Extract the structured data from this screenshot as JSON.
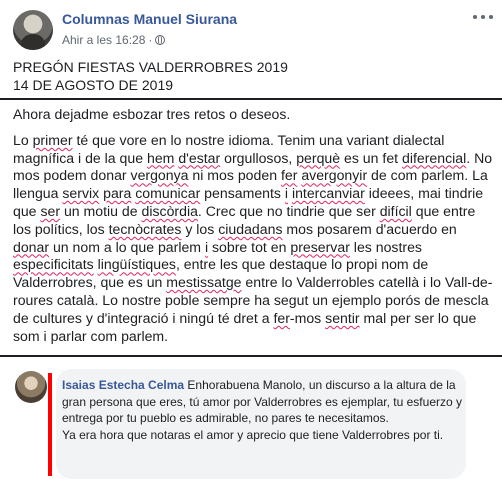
{
  "post": {
    "author": "Columnas Manuel Siurana",
    "time": "Ahir a les 16:28",
    "dot": "·",
    "title_line1": "PREGÓN FIESTAS VALDERROBRES 2019",
    "title_line2": "14 DE AGOSTO DE 2019"
  },
  "body": {
    "para1": "Ahora dejadme esbozar tres retos o deseos.",
    "p2": {
      "s01": "Lo ",
      "w01": "primer",
      "s02": " té que vore en lo nostre idioma. Tenim una variant dialectal magnífica i de la que ",
      "w02": "hem",
      "s03": " ",
      "w03": "d'estar",
      "s04": " orgullosos, ",
      "w04": "perquè",
      "s05": " es un fet ",
      "w05": "diferencial",
      "s06": ". No mos podem donar ",
      "w06": "vergonya",
      "s07": " ni mos poden ",
      "w07": "fer",
      "s08": " ",
      "w08": "avergonyir",
      "s09": " de com parlem. La llengua ",
      "w09": "servix",
      "s10": " ",
      "w10": "para",
      "s11": " ",
      "w11": "comunicar",
      "s12": " pensaments ",
      "w12": "i",
      "s13": " ",
      "w13": "intercanviar",
      "s14": " ideees, mai tindrie que ",
      "w14": "ser",
      "s15": " un motiu de ",
      "w15": "discòrdia",
      "s16": ". Crec que no tindrie que ser ",
      "w16": "difícil",
      "s17": " que entre los polítics, los ",
      "w17": "tecnòcrates",
      "s18": " y los ",
      "w18": "ciudadans",
      "s19": " mos posarem d'acuerdo en ",
      "w19": "donar",
      "s20": " un nom a lo que parlem ",
      "w20": "i",
      "s21": " sobre tot en ",
      "w21": "preservar",
      "s22": " les nostres ",
      "w22": "especificitats",
      "s23": " ",
      "w23": "lingüístiques",
      "s24": ", entre les que destaque lo propi nom de Valderrobres, que es un ",
      "w24": "mestissatge",
      "s25": " entre lo Valderrobles catellà i lo Vall-de-roures català. Lo nostre poble sempre ha segut un ejemplo porós de mescla de cultures y d'integració i ningú té dret a ",
      "w25": "fer",
      "s26": "-mos ",
      "w26": "sentir",
      "s27": " mal per ser lo que som i parlar com parlem."
    }
  },
  "comment": {
    "author": "Isaias Estecha Celma",
    "text_line1": " Enhorabuena Manolo, un discurso a la altura de la gran persona que eres, tú amor por Valderrobres es ejemplar, tu esfuerzo y entrega por tu pueblo es admirable, no pares te necesitamos.",
    "text_line2": "Ya era hora que notaras el amor y aprecio que tiene Valderrobres por ti."
  },
  "icons": {
    "privacy": "globe-icon",
    "options": "more-options-icon"
  },
  "colors": {
    "link": "#385898",
    "text": "#1c1e21",
    "meta": "#606770",
    "comment_bg": "#f2f3f5",
    "highlight_bar": "#ff0000",
    "spell_underline": "#e0245e"
  }
}
